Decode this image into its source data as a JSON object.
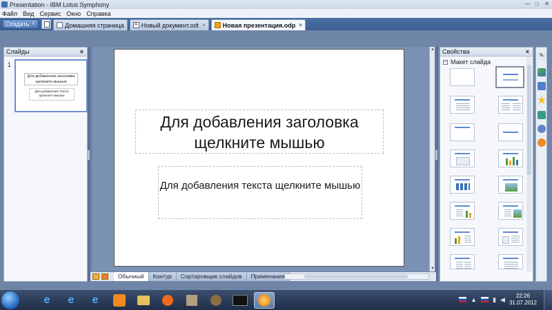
{
  "window": {
    "title": "Presentation - IBM Lotus Symphony",
    "controls": [
      "—",
      "□",
      "✕"
    ]
  },
  "menu": [
    "Файл",
    "Вид",
    "Сервис",
    "Окно",
    "Справка"
  ],
  "toolbar": {
    "create_label": "Создать",
    "create_arrow": "⇩"
  },
  "tabs": [
    {
      "label": "Домашняя страница",
      "icon": "home-icon",
      "close": "×"
    },
    {
      "label": "Новый документ.odt",
      "icon": "document-icon",
      "close": "×"
    },
    {
      "label": "Новая презентация.odp",
      "icon": "presentation-icon",
      "close": "×",
      "active": true
    }
  ],
  "slides_panel": {
    "title": "Слайды",
    "close": "×",
    "slide_number": "1",
    "thumb_title": "Для добавления заголовка щелкните мышью",
    "thumb_text": "Для добавления текста щелкните мышью"
  },
  "slide": {
    "title_placeholder": "Для добавления заголовка щелкните мышью",
    "content_placeholder": "Для добавления текста щелкните мышью"
  },
  "view_tabs": [
    "Обычный",
    "Контур",
    "Сортировщик слайдов",
    "Примечания"
  ],
  "active_view": "Обычный",
  "properties": {
    "title": "Свойства",
    "close": "×",
    "section": "Макет слайда",
    "collapse": "−"
  },
  "taskbar": {
    "time": "22:26",
    "date": "31.07.2012",
    "icons": [
      "ie-icon",
      "explorer-icon",
      "ie-icon",
      "odnoklassniki-icon",
      "folder-icon",
      "media-player-icon",
      "tools-icon",
      "bug-icon",
      "aimp-icon",
      "symphony-icon"
    ]
  },
  "colors": {
    "tab_bar": "#3c5f92",
    "workspace": "#7b92b4",
    "accent": "#5b87d6"
  }
}
